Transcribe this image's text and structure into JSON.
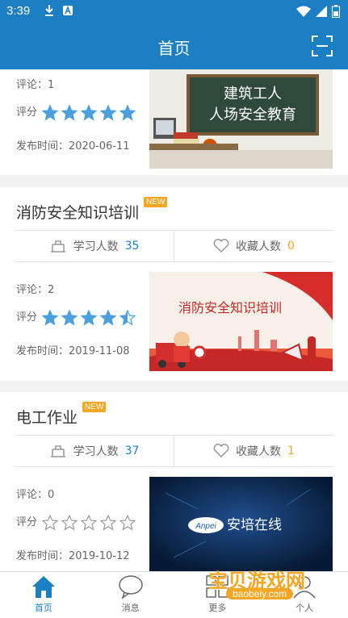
{
  "status_bar": {
    "time": "3:39"
  },
  "app_bar": {
    "title": "首页"
  },
  "cards": [
    {
      "comments_label": "评论：",
      "comments": "1",
      "rating_label": "评分",
      "rating": 5,
      "date_label": "发布时间：",
      "date": "2020-06-11",
      "thumb_text": [
        "建筑工人",
        "人场安全教育"
      ]
    },
    {
      "title": "消防安全知识培训",
      "badge": "NEW",
      "learners_label": "学习人数",
      "learners": "35",
      "favorites_label": "收藏人数",
      "favorites": "0",
      "comments_label": "评论：",
      "comments": "2",
      "rating_label": "评分",
      "rating": 4.5,
      "date_label": "发布时间：",
      "date": "2019-11-08",
      "thumb_text": "消防安全知识培训"
    },
    {
      "title": "电工作业",
      "badge": "NEW",
      "learners_label": "学习人数",
      "learners": "37",
      "favorites_label": "收藏人数",
      "favorites": "1",
      "comments_label": "评论：",
      "comments": "0",
      "rating_label": "评分",
      "rating": 0,
      "date_label": "发布时间：",
      "date": "2019-10-12",
      "thumb_text": [
        "Anpei",
        "安培在线"
      ]
    }
  ],
  "bottom_nav": [
    {
      "label": "首页",
      "icon": "home-icon",
      "active": true
    },
    {
      "label": "消息",
      "icon": "message-icon",
      "active": false
    },
    {
      "label": "更多",
      "icon": "more-icon",
      "active": false
    },
    {
      "label": "个人",
      "icon": "person-icon",
      "active": false
    }
  ],
  "watermark": {
    "big": "宝贝游戏网",
    "small": "baobeiy.com"
  },
  "colors": {
    "primary": "#1c7fc4",
    "accent": "#f5a623",
    "star": "#4a9fdc"
  }
}
